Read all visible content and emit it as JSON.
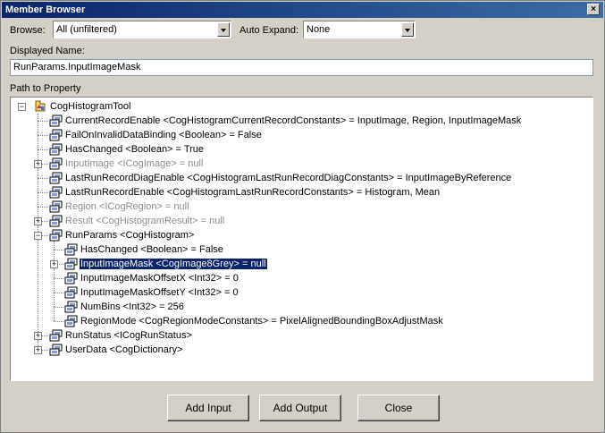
{
  "window": {
    "title": "Member Browser",
    "close_glyph": "×"
  },
  "browse": {
    "label": "Browse:",
    "value": "All (unfiltered)"
  },
  "auto_expand": {
    "label": "Auto Expand:",
    "value": "None"
  },
  "displayed_name": {
    "label": "Displayed Name:",
    "value": "RunParams.InputImageMask"
  },
  "path": {
    "label": "Path to Property"
  },
  "tree": {
    "root": "CogHistogramTool",
    "items": [
      {
        "text": "CurrentRecordEnable <CogHistogramCurrentRecordConstants> = InputImage, Region, InputImageMask",
        "level": 1,
        "expandable": false,
        "grey": false
      },
      {
        "text": "FailOnInvalidDataBinding <Boolean> = False",
        "level": 1,
        "expandable": false,
        "grey": false
      },
      {
        "text": "HasChanged <Boolean> = True",
        "level": 1,
        "expandable": false,
        "grey": false
      },
      {
        "text": "InputImage <ICogImage> = null",
        "level": 1,
        "expandable": true,
        "expanded": false,
        "grey": true
      },
      {
        "text": "LastRunRecordDiagEnable <CogHistogramLastRunRecordDiagConstants> = InputImageByReference",
        "level": 1,
        "expandable": false,
        "grey": false
      },
      {
        "text": "LastRunRecordEnable <CogHistogramLastRunRecordConstants> = Histogram, Mean",
        "level": 1,
        "expandable": false,
        "grey": false
      },
      {
        "text": "Region <ICogRegion> = null",
        "level": 1,
        "expandable": false,
        "grey": true
      },
      {
        "text": "Result <CogHistogramResult> = null",
        "level": 1,
        "expandable": true,
        "expanded": false,
        "grey": true
      },
      {
        "text": "RunParams <CogHistogram>",
        "level": 1,
        "expandable": true,
        "expanded": true,
        "grey": false
      },
      {
        "text": "HasChanged <Boolean> = False",
        "level": 2,
        "expandable": false,
        "grey": false
      },
      {
        "text": "InputImageMask <CogImage8Grey> = null",
        "level": 2,
        "expandable": true,
        "expanded": false,
        "grey": false,
        "selected": true
      },
      {
        "text": "InputImageMaskOffsetX <Int32> = 0",
        "level": 2,
        "expandable": false,
        "grey": false
      },
      {
        "text": "InputImageMaskOffsetY <Int32> = 0",
        "level": 2,
        "expandable": false,
        "grey": false
      },
      {
        "text": "NumBins <Int32> = 256",
        "level": 2,
        "expandable": false,
        "grey": false
      },
      {
        "text": "RegionMode <CogRegionModeConstants> = PixelAlignedBoundingBoxAdjustMask",
        "level": 2,
        "expandable": false,
        "grey": false
      },
      {
        "text": "RunStatus <ICogRunStatus>",
        "level": 1,
        "expandable": true,
        "expanded": false,
        "grey": false
      },
      {
        "text": "UserData <CogDictionary>",
        "level": 1,
        "expandable": true,
        "expanded": false,
        "grey": false
      }
    ]
  },
  "buttons": {
    "add_input": "Add Input",
    "add_output": "Add Output",
    "close": "Close"
  },
  "icons": {
    "property": "property-icon",
    "tool": "tool-icon"
  },
  "colors": {
    "titlebar": "#0a246a",
    "selection": "#0a246a",
    "disabled_text": "#8c8c8c"
  }
}
